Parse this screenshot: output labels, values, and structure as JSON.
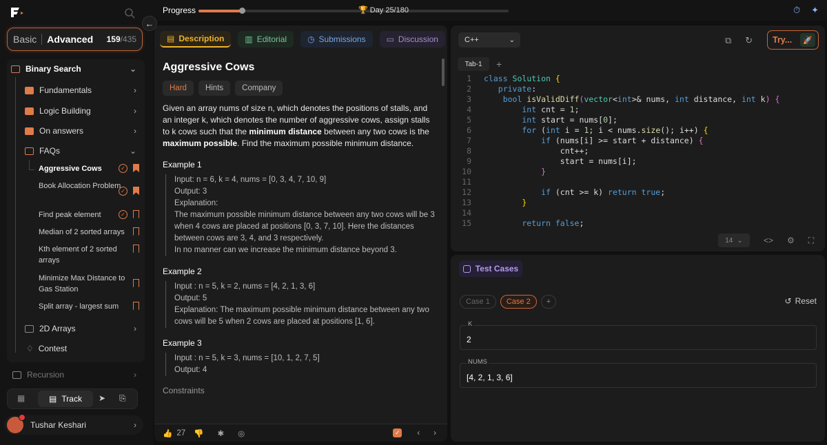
{
  "sidebar": {
    "mode_basic": "Basic",
    "mode_advanced": "Advanced",
    "progress_done": "159",
    "progress_total": "/435",
    "sections": [
      {
        "label": "Binary Search"
      },
      {
        "label": "Fundamentals"
      },
      {
        "label": "Logic Building"
      },
      {
        "label": "On answers"
      },
      {
        "label": "FAQs"
      },
      {
        "label": "2D Arrays"
      },
      {
        "label": "Contest"
      }
    ],
    "problems": [
      {
        "label": "Aggressive Cows",
        "solved": true,
        "bookmarked": true
      },
      {
        "label": "Book Allocation Problem",
        "solved": true,
        "bookmarked": true
      },
      {
        "label": "Find peak element",
        "solved": true,
        "bookmarked": false
      },
      {
        "label": "Median of 2 sorted arrays",
        "solved": false,
        "bookmarked": false
      },
      {
        "label": "Kth element of 2 sorted arrays",
        "solved": false,
        "bookmarked": false
      },
      {
        "label": "Minimize Max Distance to Gas Station",
        "solved": false,
        "bookmarked": false
      },
      {
        "label": "Split array - largest sum",
        "solved": false,
        "bookmarked": false
      }
    ],
    "recursion": "Recursion",
    "track_label": "Track",
    "user_name": "Tushar Keshari"
  },
  "topbar": {
    "progress_label": "Progress",
    "progress_fraction": 0.139,
    "day_text": "Day 25/180"
  },
  "problem": {
    "tabs": [
      "Description",
      "Editorial",
      "Submissions",
      "Discussion"
    ],
    "title": "Aggressive Cows",
    "tags": [
      "Hard",
      "Hints",
      "Company"
    ],
    "statement_1": "Given an array nums of size n, which denotes the positions of stalls, and an integer k, which denotes the number of aggressive cows, assign stalls to k cows such that the ",
    "statement_b1": "minimum distance",
    "statement_2": " between any two cows is the ",
    "statement_b2": "maximum possible",
    "statement_3": ". Find the maximum possible minimum distance.",
    "examples": [
      {
        "heading": "Example 1",
        "lines": [
          "Input: n = 6, k = 4, nums = [0, 3, 4, 7, 10, 9]",
          "Output: 3",
          "Explanation:",
          "The maximum possible minimum distance between any two cows will be 3 when 4 cows are placed at positions [0, 3, 7, 10]. Here the distances between cows are 3, 4, and 3 respectively.",
          "In no manner can we increase the minimum distance beyond 3."
        ]
      },
      {
        "heading": "Example 2",
        "lines": [
          "Input : n = 5, k = 2, nums = [4, 2, 1, 3, 6]",
          "Output: 5",
          "Explanation: The maximum possible minimum distance between any two cows will be 5 when 2 cows are placed at positions [1, 6]."
        ]
      },
      {
        "heading": "Example 3",
        "lines": [
          "Input : n = 5, k = 3, nums = [10, 1, 2, 7, 5]",
          "Output:  4"
        ]
      }
    ],
    "constraints_heading": "Constraints",
    "likes": "27"
  },
  "editor": {
    "language": "C++",
    "try_label": "Try...",
    "file_tab": "Tab-1",
    "font_size": "14",
    "code_lines": [
      "class Solution {",
      "   private:",
      "    bool isValidDiff(vector<int>& nums, int distance, int k) {",
      "        int cnt = 1;",
      "        int start = nums[0];",
      "        for (int i = 1; i < nums.size(); i++) {",
      "            if (nums[i] >= start + distance) {",
      "                cnt++;",
      "                start = nums[i];",
      "            }",
      "",
      "            if (cnt >= k) return true;",
      "        }",
      "",
      "        return false;"
    ]
  },
  "testcases": {
    "tab_label": "Test Cases",
    "cases": [
      "Case 1",
      "Case 2"
    ],
    "add_label": "+",
    "reset_label": "Reset",
    "fields": [
      {
        "label": "K",
        "value": "2"
      },
      {
        "label": "NUMS",
        "value": "[4, 2, 1, 3, 6]"
      }
    ]
  },
  "colors": {
    "accent": "#e07b4a",
    "gold": "#f0b429"
  }
}
